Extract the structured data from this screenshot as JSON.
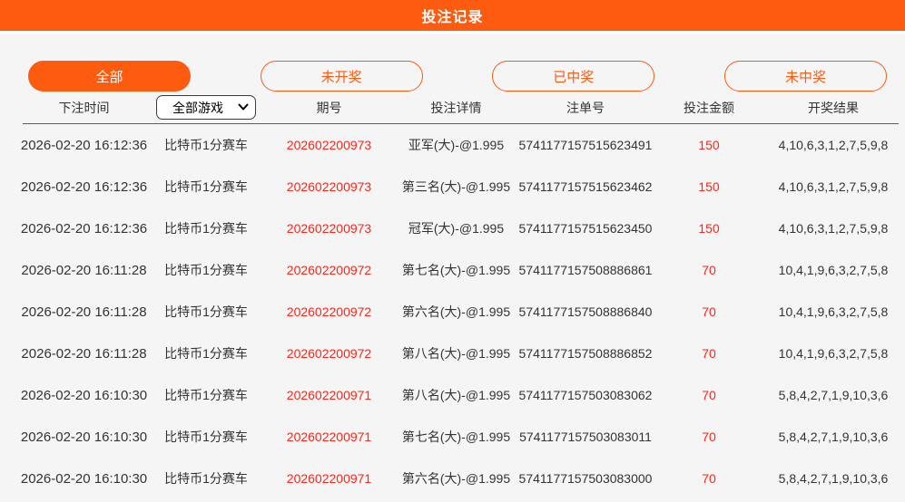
{
  "header": {
    "title": "投注记录"
  },
  "filters": [
    {
      "label": "全部",
      "active": true
    },
    {
      "label": "未开奖",
      "active": false
    },
    {
      "label": "已中奖",
      "active": false
    },
    {
      "label": "未中奖",
      "active": false
    }
  ],
  "table": {
    "columns": {
      "time": "下注时间",
      "game_select": "全部游戏",
      "period": "期号",
      "detail": "投注详情",
      "order": "注单号",
      "amount": "投注金额",
      "result": "开奖结果"
    },
    "rows": [
      {
        "time": "2026-02-20 16:12:36",
        "game": "比特币1分赛车",
        "period": "202602200973",
        "detail": "亚军(大)-@1.995",
        "order": "5741177157515623491",
        "amount": "150",
        "result": "4,10,6,3,1,2,7,5,9,8"
      },
      {
        "time": "2026-02-20 16:12:36",
        "game": "比特币1分赛车",
        "period": "202602200973",
        "detail": "第三名(大)-@1.995",
        "order": "5741177157515623462",
        "amount": "150",
        "result": "4,10,6,3,1,2,7,5,9,8"
      },
      {
        "time": "2026-02-20 16:12:36",
        "game": "比特币1分赛车",
        "period": "202602200973",
        "detail": "冠军(大)-@1.995",
        "order": "5741177157515623450",
        "amount": "150",
        "result": "4,10,6,3,1,2,7,5,9,8"
      },
      {
        "time": "2026-02-20 16:11:28",
        "game": "比特币1分赛车",
        "period": "202602200972",
        "detail": "第七名(大)-@1.995",
        "order": "5741177157508886861",
        "amount": "70",
        "result": "10,4,1,9,6,3,2,7,5,8"
      },
      {
        "time": "2026-02-20 16:11:28",
        "game": "比特币1分赛车",
        "period": "202602200972",
        "detail": "第六名(大)-@1.995",
        "order": "5741177157508886840",
        "amount": "70",
        "result": "10,4,1,9,6,3,2,7,5,8"
      },
      {
        "time": "2026-02-20 16:11:28",
        "game": "比特币1分赛车",
        "period": "202602200972",
        "detail": "第八名(大)-@1.995",
        "order": "5741177157508886852",
        "amount": "70",
        "result": "10,4,1,9,6,3,2,7,5,8"
      },
      {
        "time": "2026-02-20 16:10:30",
        "game": "比特币1分赛车",
        "period": "202602200971",
        "detail": "第八名(大)-@1.995",
        "order": "5741177157503083062",
        "amount": "70",
        "result": "5,8,4,2,7,1,9,10,3,6"
      },
      {
        "time": "2026-02-20 16:10:30",
        "game": "比特币1分赛车",
        "period": "202602200971",
        "detail": "第七名(大)-@1.995",
        "order": "5741177157503083011",
        "amount": "70",
        "result": "5,8,4,2,7,1,9,10,3,6"
      },
      {
        "time": "2026-02-20 16:10:30",
        "game": "比特币1分赛车",
        "period": "202602200971",
        "detail": "第六名(大)-@1.995",
        "order": "5741177157503083000",
        "amount": "70",
        "result": "5,8,4,2,7,1,9,10,3,6"
      }
    ]
  },
  "icons": {
    "game_select_chevron": "chevron-down-icon"
  },
  "colors": {
    "accent_orange": "#fc5b10",
    "highlight_red": "#f7281c",
    "text_dark": "#333333",
    "page_background": "#f5f5f5",
    "header_rule": "#5c5c5c"
  }
}
